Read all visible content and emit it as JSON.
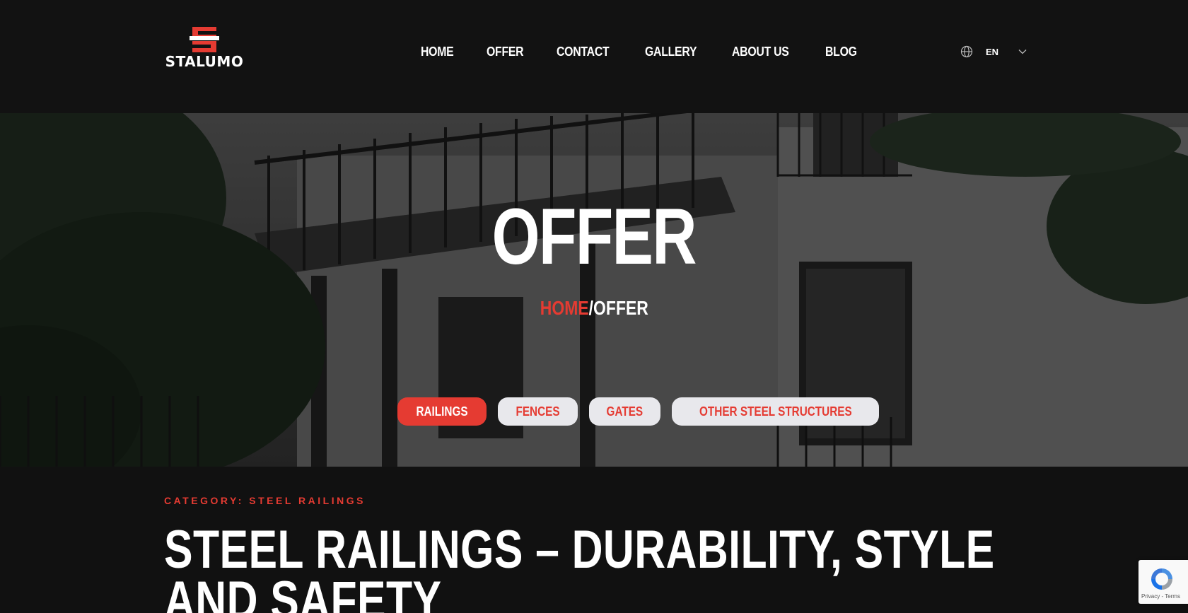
{
  "brand": {
    "name": "STALUMO",
    "accent_color": "#e53b32"
  },
  "nav": {
    "items": [
      {
        "label": "HOME"
      },
      {
        "label": "OFFER"
      },
      {
        "label": "CONTACT"
      },
      {
        "label": "GALLERY"
      },
      {
        "label": "ABOUT US"
      },
      {
        "label": "BLOG"
      }
    ]
  },
  "language": {
    "icon": "globe-icon",
    "code": "EN",
    "dropdown_icon": "chevron-down-icon"
  },
  "hero": {
    "title": "OFFER",
    "breadcrumb": {
      "home": "HOME",
      "separator": "/",
      "current": "OFFER"
    },
    "filters": [
      {
        "label": "RAILINGS",
        "active": true
      },
      {
        "label": "FENCES",
        "active": false
      },
      {
        "label": "GATES",
        "active": false
      },
      {
        "label": "OTHER STEEL STRUCTURES",
        "active": false
      }
    ]
  },
  "post": {
    "category": "CATEGORY: STEEL RAILINGS",
    "title": "STEEL RAILINGS – DURABILITY, STYLE AND SAFETY"
  },
  "recaptcha": {
    "links": "Privacy - Terms"
  }
}
